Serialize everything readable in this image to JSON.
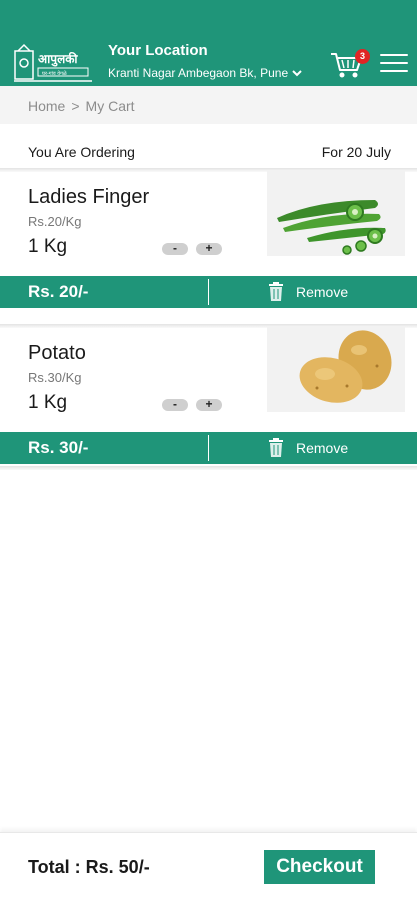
{
  "header": {
    "logo_text": "आपुलकी",
    "logo_subtext": "घर-गांव वेगळे",
    "location_title": "Your Location",
    "location_value": "Kranti Nagar Ambegaon Bk, Pune",
    "cart_count": "3",
    "brand_color": "#1f9579"
  },
  "breadcrumb": {
    "home": "Home",
    "separator": ">",
    "current": "My Cart"
  },
  "order": {
    "label": "You Are Ordering",
    "date": "For 20 July"
  },
  "items": [
    {
      "name": "Ladies Finger",
      "unit_price": "Rs.20/Kg",
      "quantity": "1 Kg",
      "decrement": "-",
      "increment": "+",
      "total": "Rs. 20/-",
      "remove_label": "Remove",
      "image_icon": "okra-image"
    },
    {
      "name": "Potato",
      "unit_price": "Rs.30/Kg",
      "quantity": "1 Kg",
      "decrement": "-",
      "increment": "+",
      "total": "Rs. 30/-",
      "remove_label": "Remove",
      "image_icon": "potato-image"
    }
  ],
  "footer": {
    "total": "Total : Rs. 50/-",
    "checkout_label": "Checkout"
  }
}
